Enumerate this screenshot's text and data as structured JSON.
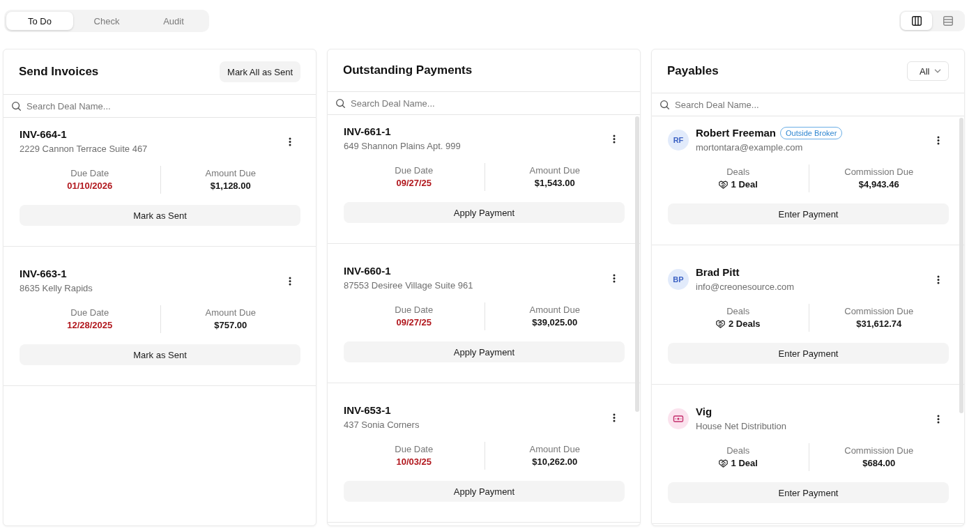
{
  "tabs": [
    {
      "label": "To Do",
      "selected": true
    },
    {
      "label": "Check",
      "selected": false
    },
    {
      "label": "Audit",
      "selected": false
    }
  ],
  "view_toggle": [
    {
      "kind": "columns",
      "selected": true
    },
    {
      "kind": "rows",
      "selected": false
    }
  ],
  "panels": [
    {
      "title": "Send Invoices",
      "action": "Mark All as Sent",
      "search": {
        "placeholder": "Search Deal Name..."
      },
      "cards": [
        {
          "kind": "invoice",
          "title": "INV-664-1",
          "subtitle": "2229 Cannon Terrace Suite 467",
          "stats": [
            {
              "kind": "date",
              "label": "Due Date",
              "value": "01/10/2026"
            },
            {
              "kind": "amount",
              "label": "Amount Due",
              "value": "$1,128.00"
            }
          ],
          "button": "Mark as Sent"
        },
        {
          "kind": "invoice",
          "title": "INV-663-1",
          "subtitle": "8635 Kelly Rapids",
          "stats": [
            {
              "kind": "date",
              "label": "Due Date",
              "value": "12/28/2025"
            },
            {
              "kind": "amount",
              "label": "Amount Due",
              "value": "$757.00"
            }
          ],
          "button": "Mark as Sent"
        }
      ]
    },
    {
      "title": "Outstanding Payments",
      "search": {
        "placeholder": "Search Deal Name..."
      },
      "cards": [
        {
          "kind": "invoice",
          "title": "INV-661-1",
          "subtitle": "649 Shannon Plains Apt. 999",
          "stats": [
            {
              "kind": "date",
              "label": "Due Date",
              "value": "09/27/25"
            },
            {
              "kind": "amount",
              "label": "Amount Due",
              "value": "$1,543.00"
            }
          ],
          "button": "Apply Payment"
        },
        {
          "kind": "invoice",
          "title": "INV-660-1",
          "subtitle": "87553 Desiree Village Suite 961",
          "stats": [
            {
              "kind": "date",
              "label": "Due Date",
              "value": "09/27/25"
            },
            {
              "kind": "amount",
              "label": "Amount Due",
              "value": "$39,025.00"
            }
          ],
          "button": "Apply Payment"
        },
        {
          "kind": "invoice",
          "title": "INV-653-1",
          "subtitle": "437 Sonia Corners",
          "stats": [
            {
              "kind": "date",
              "label": "Due Date",
              "value": "10/03/25"
            },
            {
              "kind": "amount",
              "label": "Amount Due",
              "value": "$10,262.00"
            }
          ],
          "button": "Apply Payment"
        }
      ]
    },
    {
      "title": "Payables",
      "filter": {
        "value": "All"
      },
      "search": {
        "placeholder": "Search Deal Name..."
      },
      "cards": [
        {
          "kind": "payee",
          "avatar": {
            "kind": "initials",
            "text": "RF"
          },
          "title": "Robert Freeman",
          "badge": "Outside Broker",
          "subtitle": "mortontara@example.com",
          "stats": [
            {
              "kind": "deals",
              "label": "Deals",
              "value": "1 Deal"
            },
            {
              "kind": "amount",
              "label": "Commission Due",
              "value": "$4,943.46"
            }
          ],
          "button": "Enter Payment"
        },
        {
          "kind": "payee",
          "avatar": {
            "kind": "initials",
            "text": "BP"
          },
          "title": "Brad Pitt",
          "subtitle": "info@creonesource.com",
          "stats": [
            {
              "kind": "deals",
              "label": "Deals",
              "value": "2 Deals"
            },
            {
              "kind": "amount",
              "label": "Commission Due",
              "value": "$31,612.74"
            }
          ],
          "button": "Enter Payment"
        },
        {
          "kind": "payee",
          "avatar": {
            "kind": "banknote"
          },
          "title": "Vig",
          "subtitle": "House Net Distribution",
          "stats": [
            {
              "kind": "deals",
              "label": "Deals",
              "value": "1 Deal"
            },
            {
              "kind": "amount",
              "label": "Commission Due",
              "value": "$684.00"
            }
          ],
          "button": "Enter Payment"
        }
      ]
    }
  ]
}
